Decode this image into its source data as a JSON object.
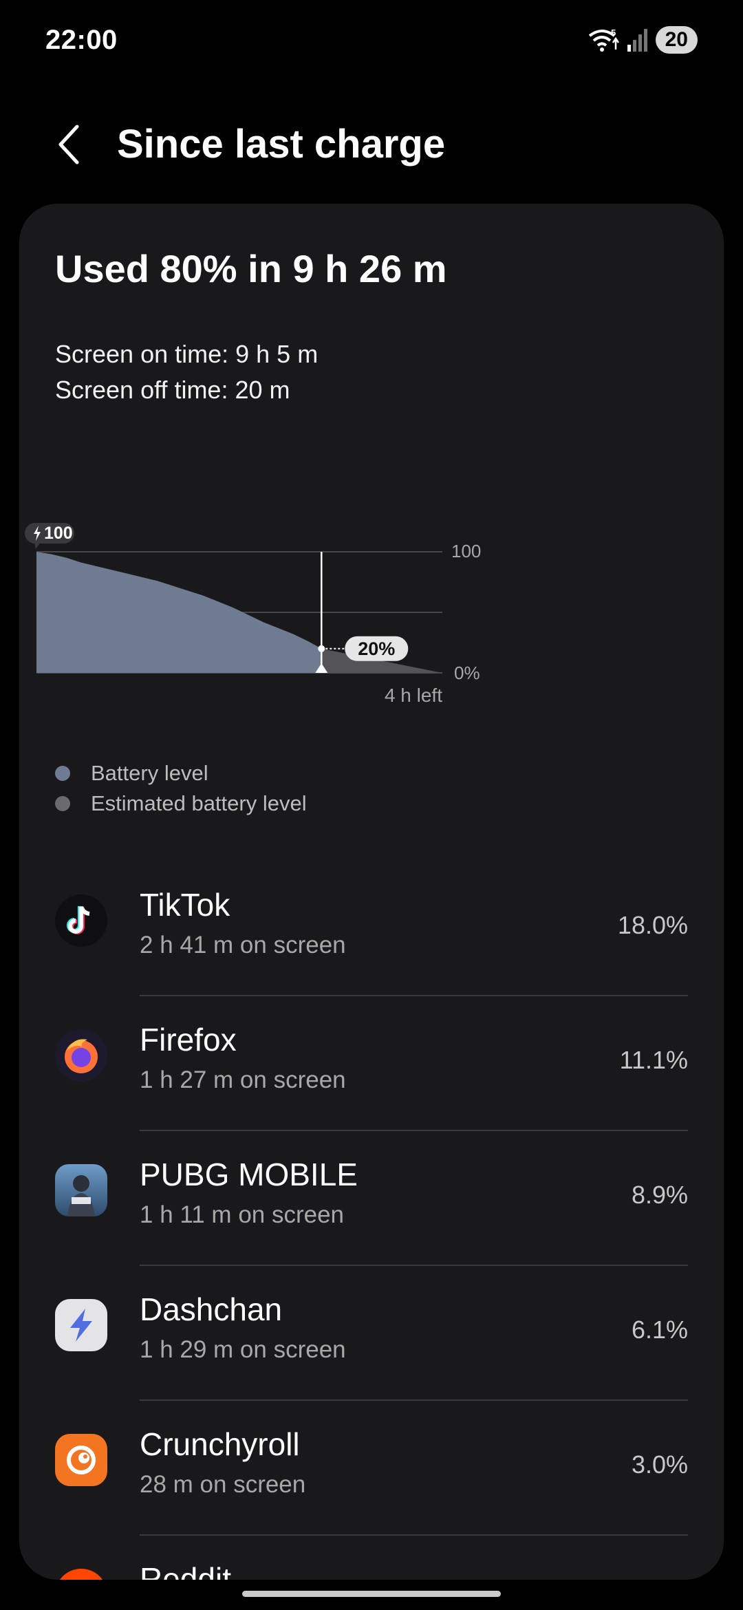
{
  "status": {
    "time": "22:00",
    "wifi_badge": "5",
    "battery": "20"
  },
  "header": {
    "title": "Since last charge"
  },
  "summary": {
    "title": "Used 80% in 9 h 26 m",
    "screen_on": "Screen on time: 9 h 5 m",
    "screen_off": "Screen off time: 20 m"
  },
  "chart_data": {
    "type": "area",
    "y_ticks": [
      "100",
      "0%"
    ],
    "ylim": [
      0,
      100
    ],
    "start_badge": "100",
    "current_label": "20%",
    "time_left": "4 h left",
    "series": [
      {
        "name": "Battery level",
        "color": "#6e7b91",
        "x": [
          0,
          0.5,
          1,
          1.5,
          2,
          2.5,
          3,
          3.5,
          4,
          4.5,
          5,
          5.5,
          6,
          6.5,
          7,
          7.5,
          8,
          8.5,
          9,
          9.43
        ],
        "values": [
          100,
          98,
          95,
          91,
          88,
          85,
          82,
          79,
          76,
          72,
          68,
          64,
          59,
          54,
          48,
          42,
          37,
          32,
          26,
          20
        ]
      },
      {
        "name": "Estimated battery level",
        "color": "#545458",
        "x": [
          9.43,
          13.43
        ],
        "values": [
          20,
          0
        ]
      }
    ],
    "legend": [
      "Battery level",
      "Estimated battery level"
    ]
  },
  "apps": [
    {
      "name": "TikTok",
      "time": "2 h 41 m on screen",
      "percent": "18.0%",
      "icon": "tiktok-icon"
    },
    {
      "name": "Firefox",
      "time": "1 h 27 m on screen",
      "percent": "11.1%",
      "icon": "firefox-icon"
    },
    {
      "name": "PUBG MOBILE",
      "time": "1 h 11 m on screen",
      "percent": "8.9%",
      "icon": "pubg-icon"
    },
    {
      "name": "Dashchan",
      "time": "1 h 29 m on screen",
      "percent": "6.1%",
      "icon": "dashchan-icon"
    },
    {
      "name": "Crunchyroll",
      "time": "28 m on screen",
      "percent": "3.0%",
      "icon": "crunchyroll-icon"
    },
    {
      "name": "Reddit",
      "time": "",
      "percent": "",
      "icon": "reddit-icon"
    }
  ]
}
